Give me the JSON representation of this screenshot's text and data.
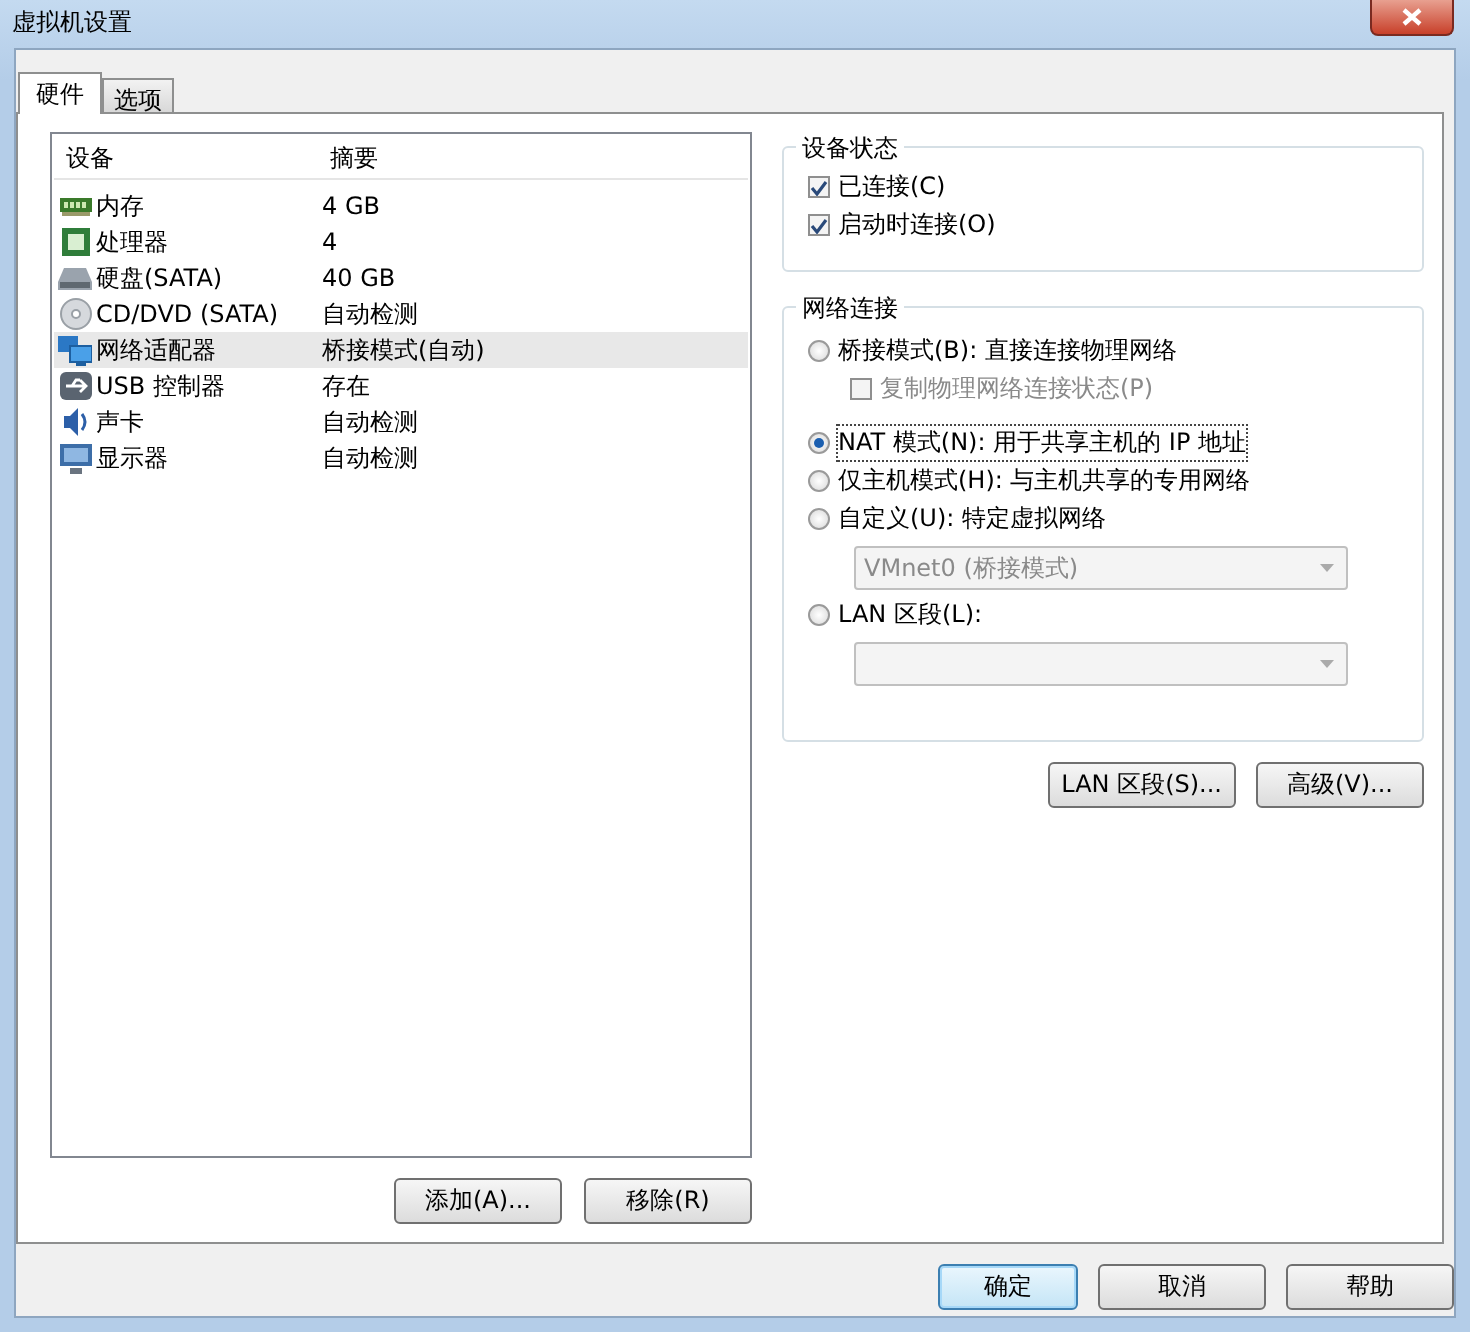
{
  "window": {
    "title": "虚拟机设置"
  },
  "tabs": [
    {
      "label": "硬件",
      "selected": true
    },
    {
      "label": "选项",
      "selected": false
    }
  ],
  "device_list": {
    "columns": [
      "设备",
      "摘要"
    ],
    "rows": [
      {
        "device": "内存",
        "summary": "4 GB",
        "selected": false
      },
      {
        "device": "处理器",
        "summary": "4",
        "selected": false
      },
      {
        "device": "硬盘(SATA)",
        "summary": "40 GB",
        "selected": false
      },
      {
        "device": "CD/DVD (SATA)",
        "summary": "自动检测",
        "selected": false
      },
      {
        "device": "网络适配器",
        "summary": "桥接模式(自动)",
        "selected": true
      },
      {
        "device": "USB 控制器",
        "summary": "存在",
        "selected": false
      },
      {
        "device": "声卡",
        "summary": "自动检测",
        "selected": false
      },
      {
        "device": "显示器",
        "summary": "自动检测",
        "selected": false
      }
    ]
  },
  "list_buttons": [
    "添加(A)...",
    "移除(R)"
  ],
  "device_status": {
    "title": "设备状态",
    "options": [
      {
        "label": "已连接(C)",
        "checked": true
      },
      {
        "label": "启动时连接(O)",
        "checked": true
      }
    ]
  },
  "network": {
    "title": "网络连接",
    "options": [
      {
        "kind": "radio",
        "label": "桥接模式(B): 直接连接物理网络",
        "selected": false
      },
      {
        "kind": "checkbox",
        "label": "复制物理网络连接状态(P)",
        "checked": false,
        "disabled": true
      },
      {
        "kind": "radio",
        "label": "NAT 模式(N): 用于共享主机的 IP 地址",
        "selected": true
      },
      {
        "kind": "radio",
        "label": "仅主机模式(H): 与主机共享的专用网络",
        "selected": false
      },
      {
        "kind": "radio",
        "label": "自定义(U): 特定虚拟网络",
        "selected": false
      },
      {
        "kind": "dropdown",
        "value": "VMnet0 (桥接模式)",
        "disabled": true
      },
      {
        "kind": "radio",
        "label": "LAN 区段(L):",
        "selected": false
      },
      {
        "kind": "dropdown",
        "disabled": true
      }
    ]
  },
  "network_buttons": [
    "LAN 区段(S)...",
    "高级(V)..."
  ],
  "dialog_buttons": [
    {
      "label": "确定",
      "default": true
    },
    {
      "label": "取消",
      "default": false
    },
    {
      "label": "帮助",
      "default": false
    }
  ]
}
